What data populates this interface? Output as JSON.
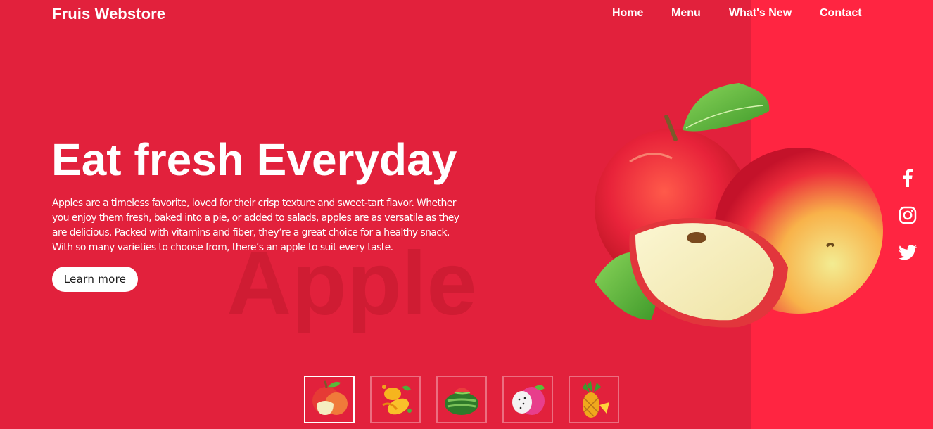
{
  "brand": {
    "name": "Fruis Webstore"
  },
  "nav": {
    "items": [
      "Home",
      "Menu",
      "What's New",
      "Contact"
    ]
  },
  "hero": {
    "headline": "Eat fresh Everyday",
    "description": "Apples are a timeless favorite, loved for their crisp texture and sweet-tart flavor. Whether you enjoy them fresh, baked into a pie, or added to salads, apples are as versatile as they are delicious. Packed with vitamins and fiber, they’re a great choice for a healthy snack. With so many varieties to choose from, there’s an apple to suit every taste.",
    "cta_label": "Learn more",
    "background_word": "Apple",
    "image_icon": "apples-image"
  },
  "social": {
    "icons": [
      "facebook-icon",
      "instagram-icon",
      "twitter-icon"
    ]
  },
  "thumbnails": {
    "selected_index": 0,
    "items": [
      {
        "icon": "apple-thumbnail"
      },
      {
        "icon": "mango-thumbnail"
      },
      {
        "icon": "watermelon-thumbnail"
      },
      {
        "icon": "dragonfruit-thumbnail"
      },
      {
        "icon": "pineapple-thumbnail"
      }
    ]
  },
  "colors": {
    "background": "#e2213c",
    "right_panel": "#ff2541",
    "text": "#ffffff",
    "button_bg": "#ffffff",
    "button_text": "#1b1b1b"
  }
}
